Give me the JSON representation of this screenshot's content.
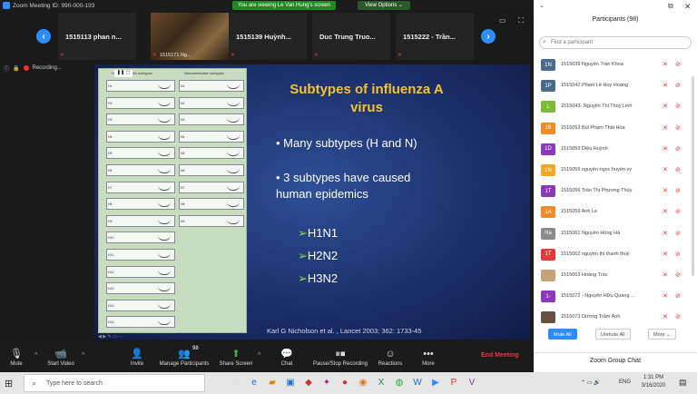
{
  "window": {
    "title": "Zoom Meeting ID: 990-000-193",
    "viewing_text": "You are viewing Le Van Hung's screen",
    "view_options": "View Options ⌄"
  },
  "strip": {
    "tiles": [
      {
        "name": "1515113 phan n..."
      },
      {
        "name": "1515171 Ng..."
      },
      {
        "name": "1515139 Huỳnh..."
      },
      {
        "name": "Duc Trung Truo..."
      },
      {
        "name": "1515222 - Trần..."
      }
    ]
  },
  "recording": {
    "label": "Recording..."
  },
  "slide": {
    "title": "Subtypes of influenza A virus",
    "bullet1": "• Many subtypes (H and N)",
    "bullet2a": "• 3 subtypes have caused",
    "bullet2b": "human epidemics",
    "subtypes": [
      "H1N1",
      "H2N2",
      "H3N2"
    ],
    "arrow": "➢",
    "citation": "Karl G Nicholson et al. , Lancet 2003; 362: 1733-45",
    "table_headers": [
      "Haemagglutinin subtypes",
      "Neuraminidase subtypes"
    ],
    "h_rows": [
      "H1",
      "H2",
      "H3",
      "H4",
      "H5",
      "H6",
      "H7",
      "H8",
      "H9",
      "H10",
      "H11",
      "H12",
      "H13",
      "H14",
      "H15"
    ],
    "n_rows": [
      "N1",
      "N2",
      "N3",
      "N4",
      "N5",
      "N6",
      "N7",
      "N8",
      "N9"
    ]
  },
  "toolbar": {
    "mute": "Mute",
    "start_video": "Start Video",
    "invite": "Invite",
    "manage_participants": "Manage Participants",
    "participants_count": "98",
    "share_screen": "Share Screen",
    "chat": "Chat",
    "recording": "Pause/Stop Recording",
    "reactions": "Reactions",
    "more": "More",
    "end_meeting": "End Meeting"
  },
  "panel": {
    "title": "Participants (98)",
    "search_placeholder": "Find a participant",
    "participants": [
      {
        "initials": "1N",
        "name": "1515039 Nguyễn Trần Khoa",
        "color": "#4a6b8a"
      },
      {
        "initials": "1P",
        "name": "1515042 Phạm Lê Huy Hoàng",
        "color": "#4a6b8a"
      },
      {
        "initials": "L",
        "name": "1515043- Nguyễn Thị Thùy Linh",
        "color": "#7cbb3a"
      },
      {
        "initials": "1B",
        "name": "1515052 Bùi Phạm Thái Hòa",
        "color": "#f08a24"
      },
      {
        "initials": "1D",
        "name": "1515053 Diệu Huỳnh",
        "color": "#8a3ab9"
      },
      {
        "initials": "1N",
        "name": "1515055 nguyễn ngọc huyền vy",
        "color": "#f5a623"
      },
      {
        "initials": "1T",
        "name": "1515056 Trần Thị Phương Thủy",
        "color": "#8a3ab9"
      },
      {
        "initials": "1A",
        "name": "1515059 Anh Le",
        "color": "#f08a24"
      },
      {
        "initials": "Ha",
        "name": "1515061 Nguyễn Hồng Hà",
        "color": "#8a8a8a"
      },
      {
        "initials": "1T",
        "name": "1515062 nguyễn thị thanh thuý",
        "color": "#e33b3b"
      },
      {
        "initials": "",
        "name": "1515063 Hoàng Trúc",
        "color": "#c9a27a"
      },
      {
        "initials": "1-",
        "name": "1515072 - Nguyễn Hữu Quang ...",
        "color": "#8a3ab9"
      },
      {
        "initials": "",
        "name": "1515073 Dương Trâm Anh",
        "color": "#6a5040"
      }
    ],
    "mute_all": "Mute All",
    "unmute_all": "Unmute All",
    "more": "More ⌄",
    "chat_title": "Zoom Group Chat"
  },
  "taskbar": {
    "search_placeholder": "Type here to search",
    "lang": "ENG",
    "time": "1:31 PM",
    "date": "3/16/2020"
  }
}
